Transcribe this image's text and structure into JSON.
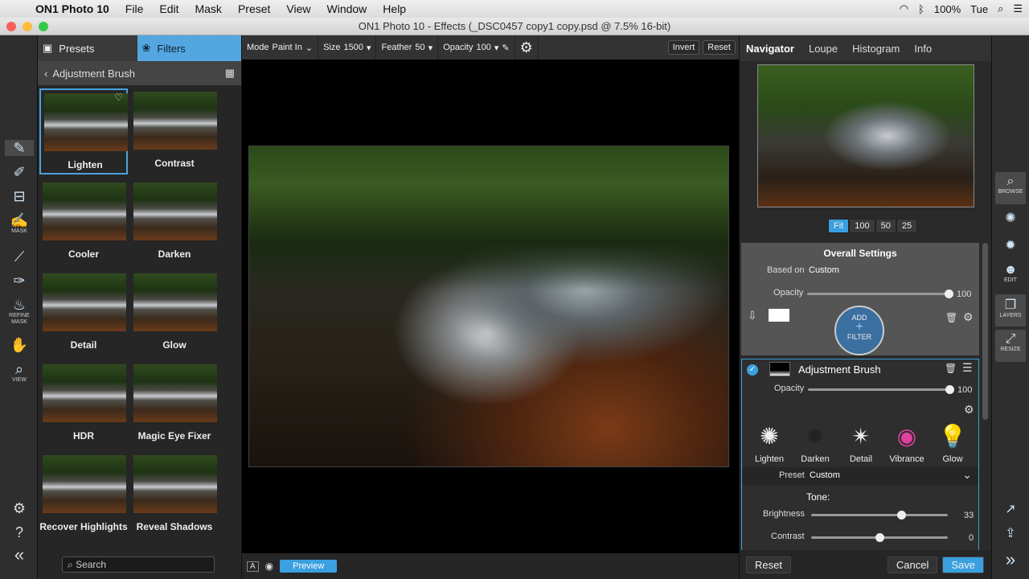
{
  "menubar": {
    "app": "ON1 Photo 10",
    "items": [
      "File",
      "Edit",
      "Mask",
      "Preset",
      "View",
      "Window",
      "Help"
    ],
    "battery": "100%",
    "time": "Tue"
  },
  "window": {
    "title": "ON1 Photo 10 - Effects (_DSC0457 copy1 copy.psd @ 7.5% 16-bit)"
  },
  "lefttools": {
    "mask": "MASK",
    "refine": "REFINE MASK",
    "view": "VIEW"
  },
  "leftpanel": {
    "tab_presets": "Presets",
    "tab_filters": "Filters",
    "header": "Adjustment Brush",
    "search_placeholder": "Search",
    "presets": [
      "Lighten",
      "Contrast",
      "Cooler",
      "Darken",
      "Detail",
      "Glow",
      "HDR",
      "Magic Eye Fixer",
      "Recover Highlights",
      "Reveal Shadows"
    ]
  },
  "toolbar": {
    "mode_label": "Mode",
    "mode_value": "Paint In",
    "size_label": "Size",
    "size_value": "1500",
    "feather_label": "Feather",
    "feather_value": "50",
    "opacity_label": "Opacity",
    "opacity_value": "100",
    "invert": "Invert",
    "reset": "Reset"
  },
  "bottombar": {
    "preview": "Preview"
  },
  "rightpanel": {
    "tabs": [
      "Navigator",
      "Loupe",
      "Histogram",
      "Info"
    ],
    "zoom": [
      "Fit",
      "100",
      "50",
      "25"
    ],
    "overall": {
      "title": "Overall Settings",
      "based_on_label": "Based on",
      "based_on_value": "Custom",
      "opacity_label": "Opacity",
      "opacity_value": "100",
      "opacity_fraction": 1.0,
      "add": "ADD",
      "filter": "FILTER"
    },
    "adjustment": {
      "title": "Adjustment Brush",
      "opacity_label": "Opacity",
      "opacity_value": "100",
      "opacity_fraction": 1.0,
      "filters": [
        {
          "label": "Lighten",
          "icon": "lighten-icon",
          "glyph": "✺"
        },
        {
          "label": "Darken",
          "icon": "darken-icon",
          "glyph": "✹"
        },
        {
          "label": "Detail",
          "icon": "detail-icon",
          "glyph": "✴"
        },
        {
          "label": "Vibrance",
          "icon": "vibrance-icon",
          "glyph": "◉"
        },
        {
          "label": "Glow",
          "icon": "glow-icon",
          "glyph": "💡"
        }
      ],
      "preset_label": "Preset",
      "preset_value": "Custom",
      "tone_label": "Tone:",
      "brightness_label": "Brightness",
      "brightness_value": "33",
      "brightness_fraction": 0.66,
      "contrast_label": "Contrast",
      "contrast_value": "0",
      "contrast_fraction": 0.5
    },
    "reset": "Reset",
    "cancel": "Cancel",
    "save": "Save"
  },
  "farright": {
    "browse": "BROWSE",
    "edit": "EDIT",
    "layers": "LAYERS",
    "resize": "RESIZE"
  }
}
